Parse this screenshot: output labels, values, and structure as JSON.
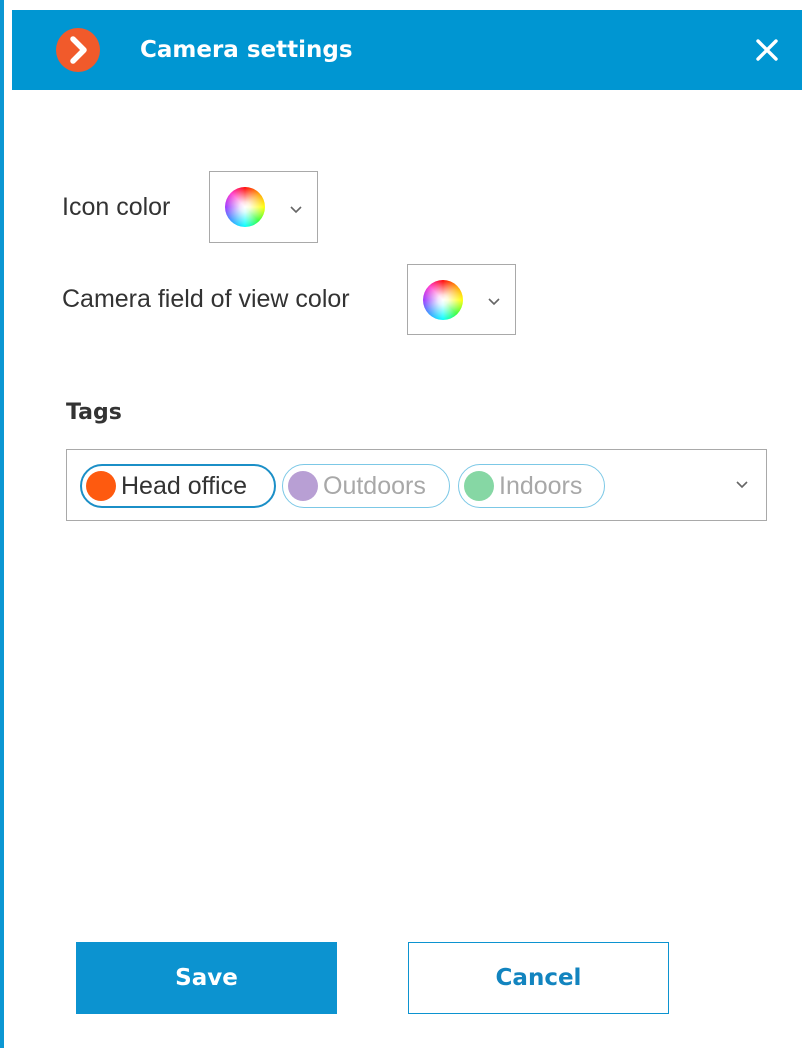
{
  "window": {
    "title": "Camera settings",
    "logo_icon": "arrow-right-logo-icon",
    "close_icon": "close-icon"
  },
  "appearance": {
    "icon_color_label": "Icon color",
    "fov_color_label": "Camera field of view color",
    "picker_icon": "color-wheel-icon"
  },
  "tags": {
    "heading": "Tags",
    "items": [
      {
        "label": "Head office",
        "color": "#fe5a0f",
        "selected": true,
        "text_color": "#333333"
      },
      {
        "label": "Outdoors",
        "color": "#b89fd4",
        "selected": false,
        "text_color": "#a8a8a8"
      },
      {
        "label": "Indoors",
        "color": "#86d7a4",
        "selected": false,
        "text_color": "#a8a8a8"
      }
    ]
  },
  "actions": {
    "save_label": "Save",
    "cancel_label": "Cancel"
  },
  "colors": {
    "accent": "#0096d2",
    "logo": "#f15a2b",
    "border": "#a9a9a9"
  }
}
